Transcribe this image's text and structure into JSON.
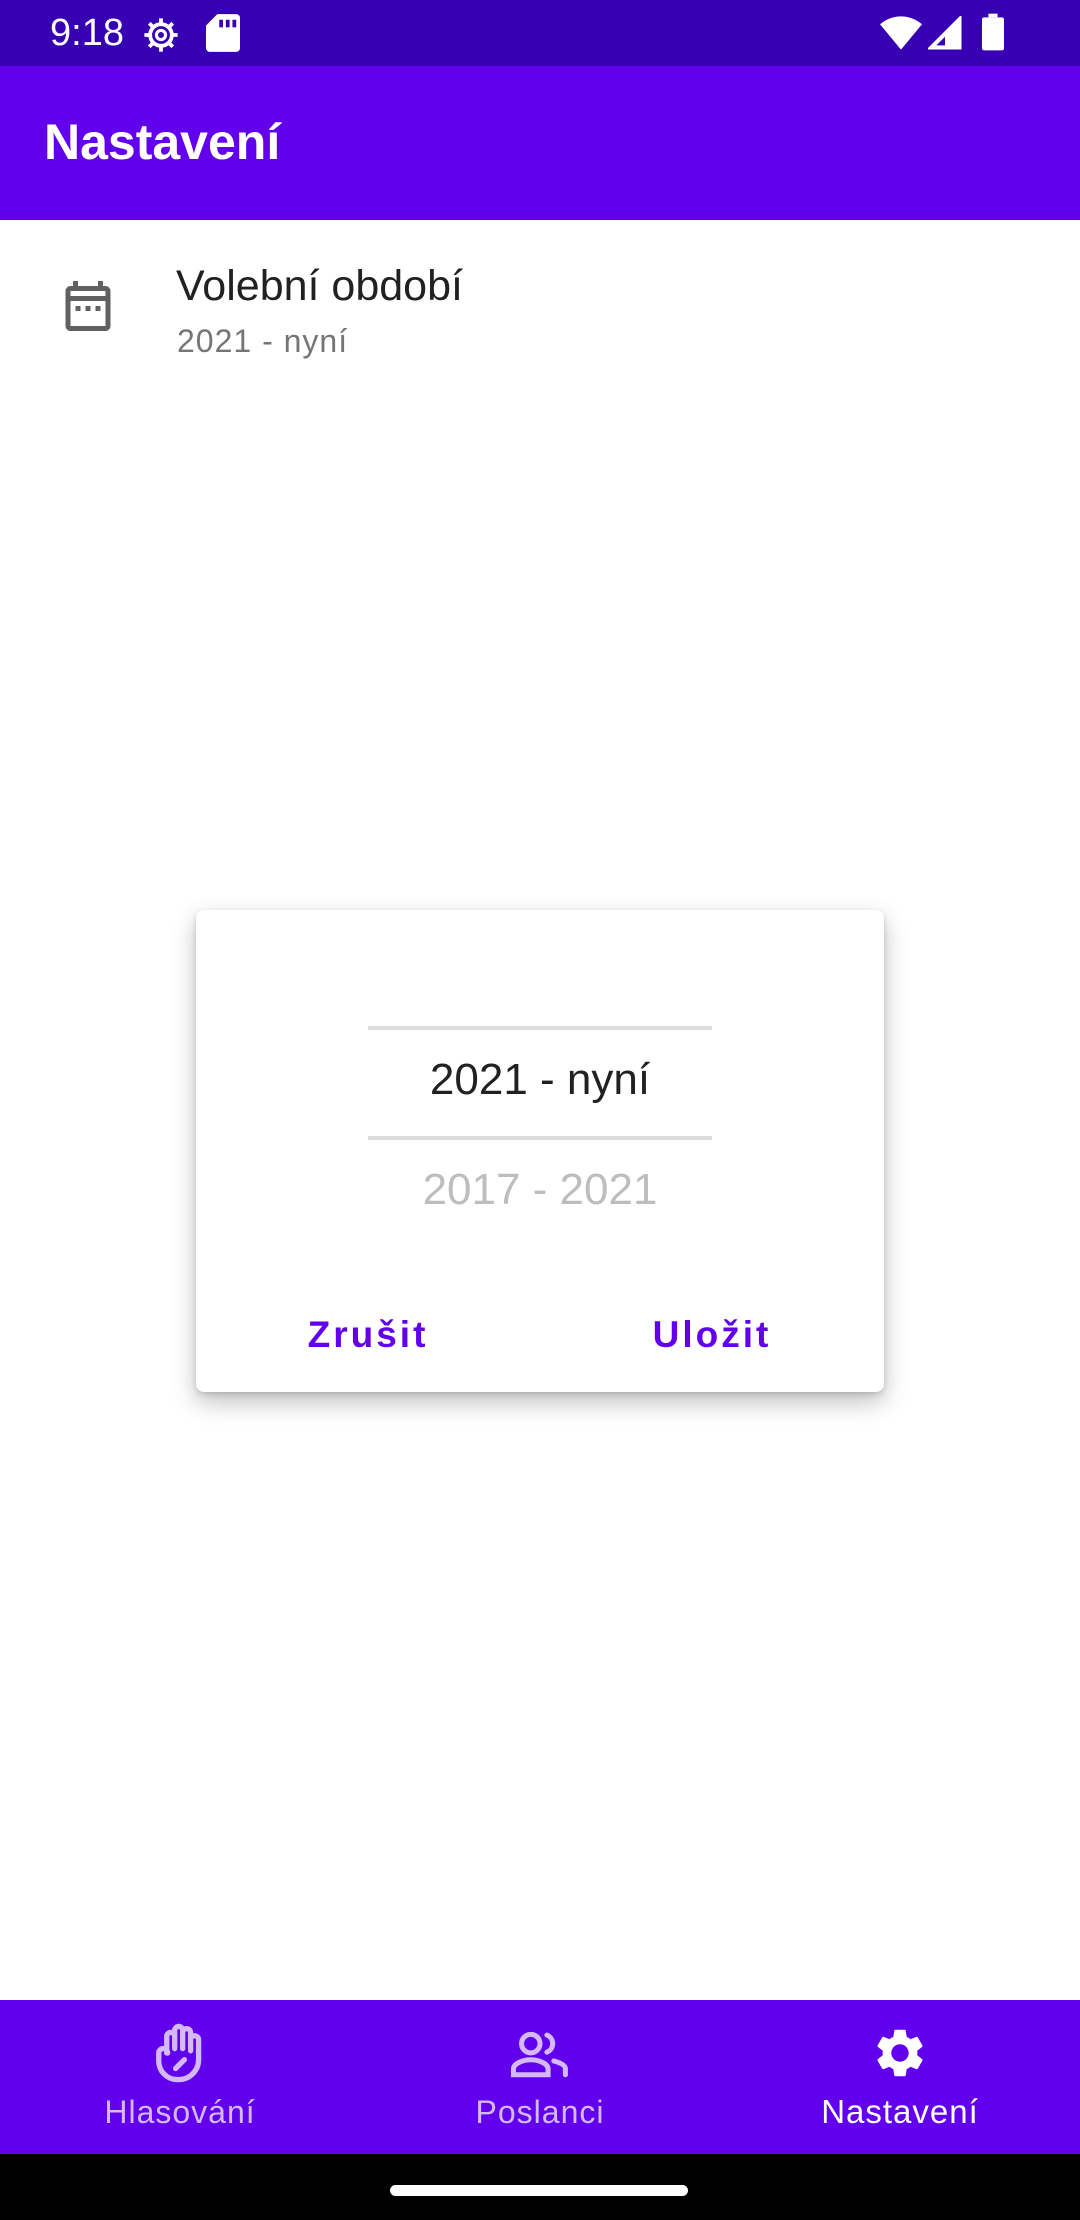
{
  "status_bar": {
    "time": "9:18",
    "icons": [
      "settings-gear-icon",
      "sd-card-icon",
      "wifi-icon",
      "cellular-signal-icon",
      "battery-icon"
    ]
  },
  "app_bar": {
    "title": "Nastavení"
  },
  "preference": {
    "icon": "calendar-icon",
    "title": "Volební období",
    "summary": "2021 - nyní"
  },
  "dialog": {
    "selected_option": "2021 - nyní",
    "next_option": "2017 - 2021",
    "cancel_label": "Zrušit",
    "save_label": "Uložit"
  },
  "bottom_nav": {
    "items": [
      {
        "label": "Hlasování",
        "icon": "raised-hand-icon",
        "active": false
      },
      {
        "label": "Poslanci",
        "icon": "people-icon",
        "active": false
      },
      {
        "label": "Nastavení",
        "icon": "gear-icon",
        "active": true
      }
    ]
  },
  "colors": {
    "primary": "#6200ee",
    "primary_dark": "#3700b3",
    "text_primary": "#212121",
    "text_secondary": "#757575",
    "picker_dim": "#bdbdbd"
  }
}
